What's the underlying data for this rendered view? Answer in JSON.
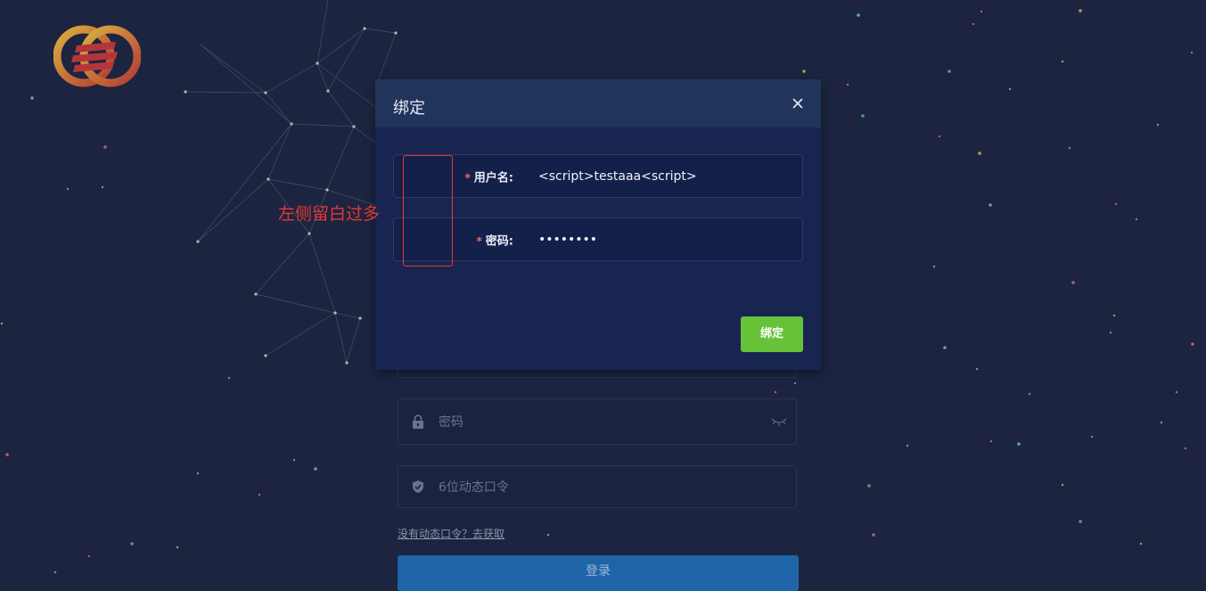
{
  "dialog": {
    "title": "绑定",
    "close_icon": "close-icon",
    "fields": [
      {
        "required_mark": "*",
        "label": "用户名:",
        "value": "<script>testaaa<script>"
      },
      {
        "required_mark": "*",
        "label": "密码:",
        "value": "••••••••"
      }
    ],
    "bind_button": "绑定"
  },
  "annotation": {
    "text": "左侧留白过多"
  },
  "login_form": {
    "password_placeholder": "密码",
    "otp_placeholder": "6位动态口令",
    "otp_link": "没有动态口令？去获取",
    "login_button": "登录"
  },
  "colors": {
    "background": "#1c2440",
    "dialog": "#182550",
    "dialog_header": "#21345a",
    "bind_button": "#67c23a",
    "annotation": "#e53935",
    "login_button": "#1f64a6"
  }
}
